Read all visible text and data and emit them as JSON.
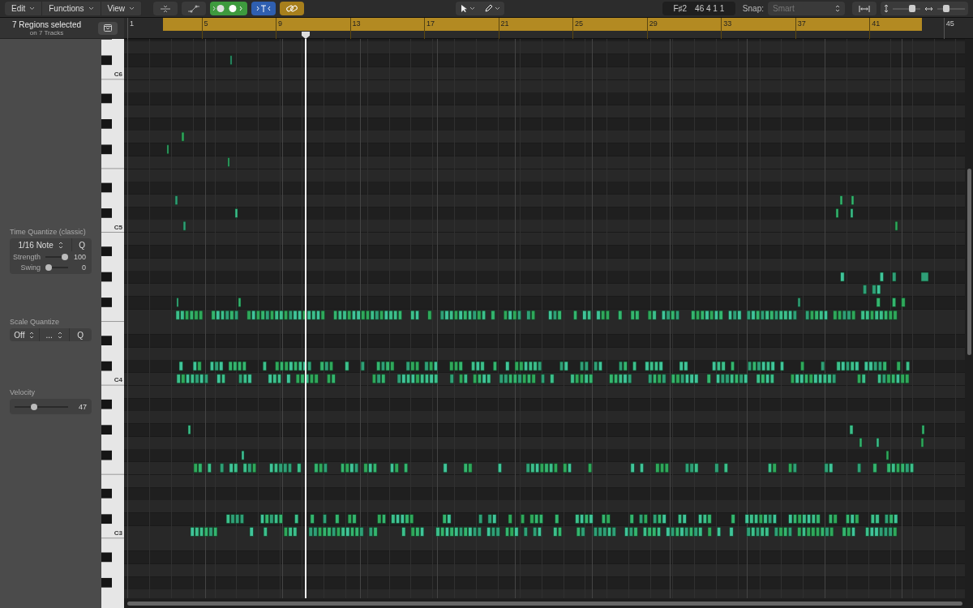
{
  "menus": [
    {
      "label": "Edit"
    },
    {
      "label": "Functions"
    },
    {
      "label": "View"
    }
  ],
  "toolbar_buttons": [
    {
      "kind": "fold",
      "on": false
    },
    {
      "kind": "automation",
      "on": false
    },
    {
      "kind": "midi_in",
      "on": true
    },
    {
      "kind": "catch",
      "on": true
    },
    {
      "kind": "link",
      "on": true
    }
  ],
  "tools": [
    {
      "kind": "pointer"
    },
    {
      "kind": "pencil"
    }
  ],
  "position": {
    "pitch": "F♯2",
    "time": "46 4 1 1"
  },
  "snap": {
    "label": "Snap:",
    "value": "Smart"
  },
  "zoom": {
    "vertical": {
      "level": 0.75
    },
    "horizontal": {
      "level": 0.25
    }
  },
  "region_info": {
    "title": "7 Regions selected",
    "subtitle": "on 7 Tracks"
  },
  "ruler": {
    "bars": [
      "1",
      "5",
      "9",
      "13",
      "17",
      "21",
      "25",
      "29",
      "33",
      "37",
      "41",
      "45"
    ]
  },
  "piano": {
    "labels": [
      "C6",
      "C5",
      "C4",
      "C3"
    ]
  },
  "time_quantize": {
    "title": "Time Quantize (classic)",
    "value": "1/16 Note",
    "button": "Q",
    "strength": {
      "label": "Strength",
      "level": 1,
      "reading": "100"
    },
    "swing": {
      "label": "Swing",
      "level": 0,
      "reading": "0"
    }
  },
  "scale_quantize": {
    "title": "Scale Quantize",
    "root": "Off",
    "scale": "...",
    "button": "Q"
  },
  "velocity": {
    "title": "Velocity",
    "level": 0.35,
    "reading": "47"
  }
}
